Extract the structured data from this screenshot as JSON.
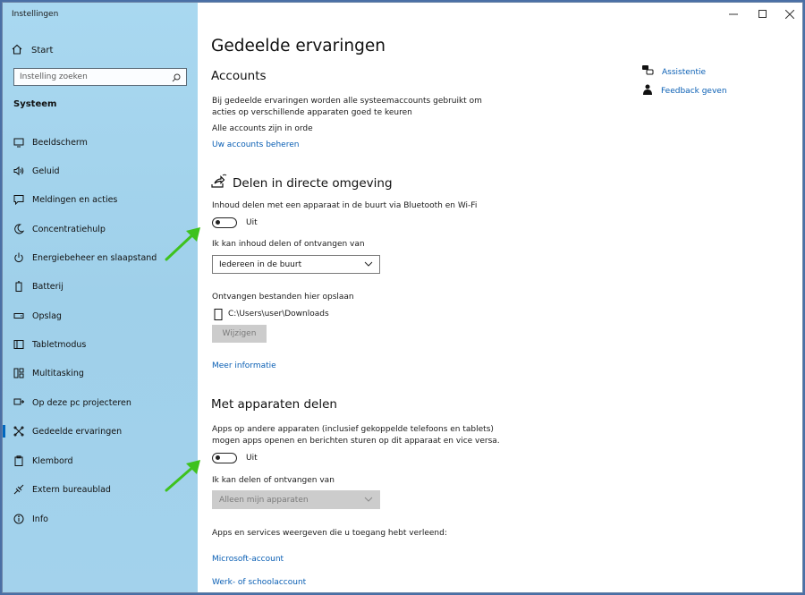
{
  "window": {
    "title": "Instellingen"
  },
  "sidebar": {
    "home_label": "Start",
    "search_placeholder": "Instelling zoeken",
    "section_label": "Systeem",
    "items": [
      {
        "label": "Beeldscherm",
        "icon": "monitor-icon"
      },
      {
        "label": "Geluid",
        "icon": "speaker-icon"
      },
      {
        "label": "Meldingen en acties",
        "icon": "notifications-icon"
      },
      {
        "label": "Concentratiehulp",
        "icon": "moon-icon"
      },
      {
        "label": "Energiebeheer en slaapstand",
        "icon": "power-icon"
      },
      {
        "label": "Batterij",
        "icon": "battery-icon"
      },
      {
        "label": "Opslag",
        "icon": "storage-icon"
      },
      {
        "label": "Tabletmodus",
        "icon": "tablet-icon"
      },
      {
        "label": "Multitasking",
        "icon": "multitasking-icon"
      },
      {
        "label": "Op deze pc projecteren",
        "icon": "project-icon"
      },
      {
        "label": "Gedeelde ervaringen",
        "icon": "shared-experiences-icon",
        "active": true
      },
      {
        "label": "Klembord",
        "icon": "clipboard-icon"
      },
      {
        "label": "Extern bureaublad",
        "icon": "remote-desktop-icon"
      },
      {
        "label": "Info",
        "icon": "info-icon"
      }
    ]
  },
  "main": {
    "title": "Gedeelde ervaringen",
    "accounts": {
      "heading": "Accounts",
      "description_line1": "Bij gedeelde ervaringen worden alle systeemaccounts gebruikt om",
      "description_line2": "acties op verschillende apparaten goed te keuren",
      "status": "Alle accounts zijn in orde",
      "manage_link": "Uw accounts beheren"
    },
    "nearby": {
      "heading": "Delen in directe omgeving",
      "toggle_description": "Inhoud delen met een apparaat in de buurt via Bluetooth en Wi-Fi",
      "toggle_state": "Uit",
      "share_label": "Ik kan inhoud delen of ontvangen van",
      "share_value": "Iedereen in de buurt",
      "save_label": "Ontvangen bestanden hier opslaan",
      "save_path": "C:\\Users\\user\\Downloads",
      "change_button": "Wijzigen",
      "more_info": "Meer informatie"
    },
    "devices": {
      "heading": "Met apparaten delen",
      "description_line1": "Apps op andere apparaten (inclusief gekoppelde telefoons en tablets)",
      "description_line2": "mogen apps openen en berichten sturen op dit apparaat en vice versa.",
      "toggle_state": "Uit",
      "share_label": "Ik kan delen of ontvangen van",
      "share_value": "Alleen mijn apparaten",
      "apps_label": "Apps en services weergeven die u toegang hebt verleend:",
      "ms_account_link": "Microsoft-account",
      "work_account_link": "Werk- of schoolaccount"
    },
    "side_links": {
      "help": "Assistentie",
      "feedback": "Feedback geven"
    }
  },
  "colors": {
    "sidebar_bg": "#a9d8f0",
    "link": "#0a5fb4",
    "accent": "#0067c0",
    "annotation_arrow": "#3ec21e"
  }
}
